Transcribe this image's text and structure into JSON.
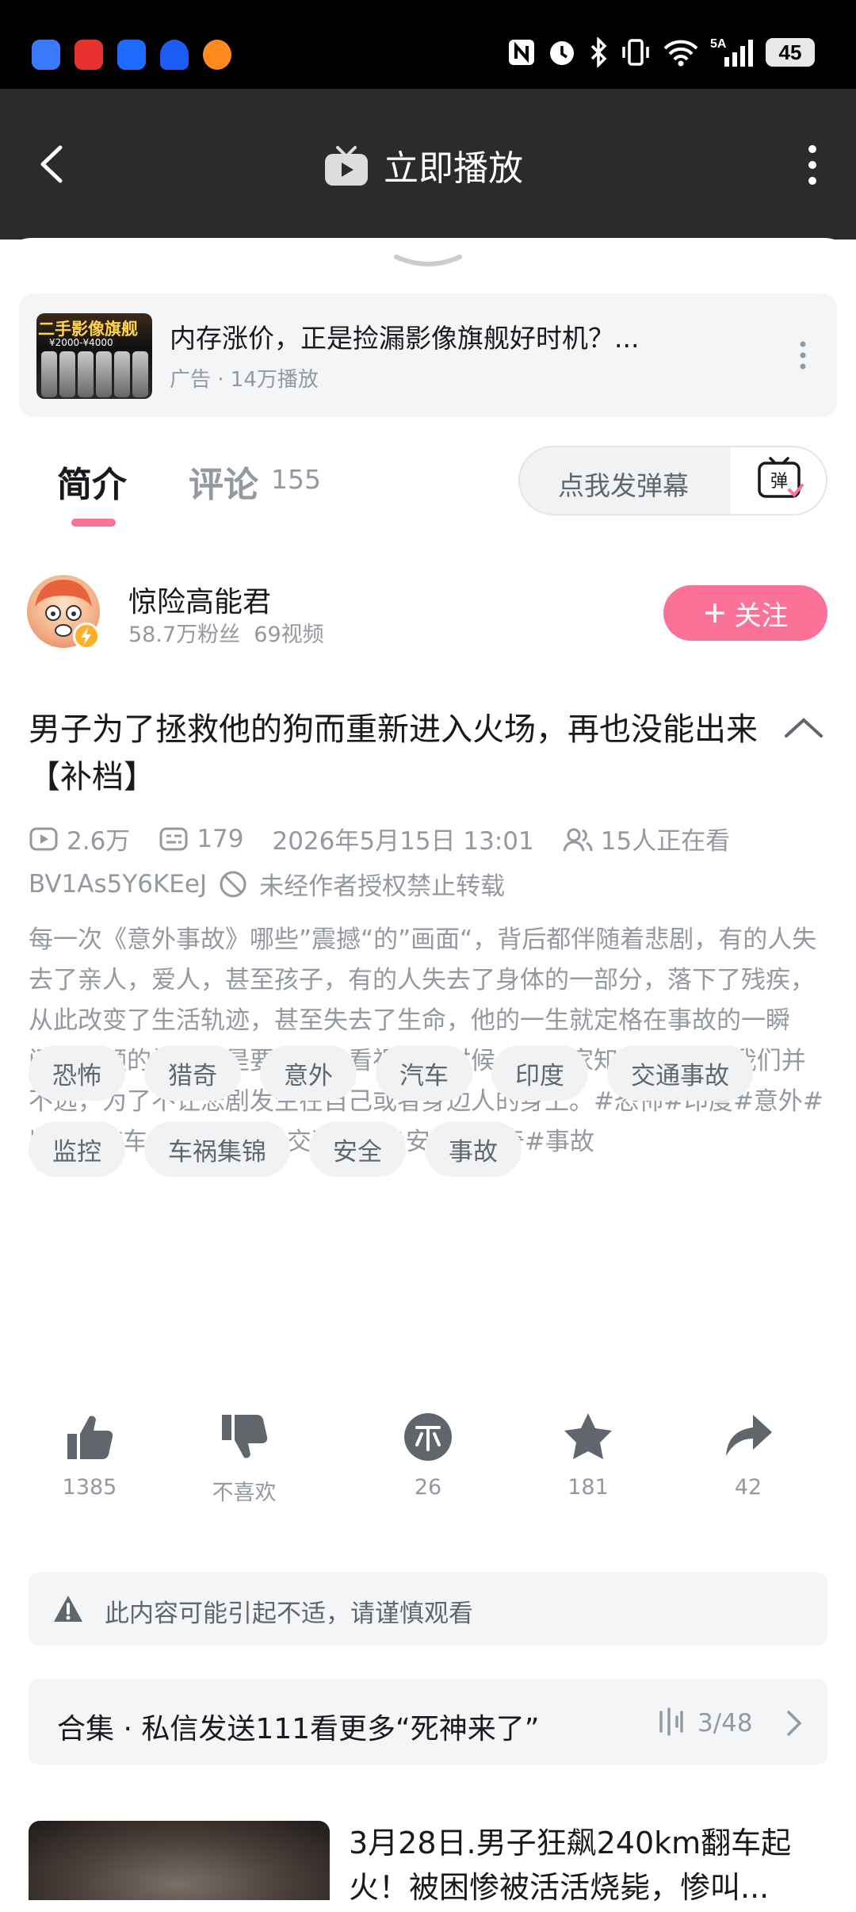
{
  "colors": {
    "accent": "#fb7299",
    "nav_bg": "#2b2b2d",
    "muted": "#9499a0"
  },
  "status_bar": {
    "network": "5A",
    "battery": "45"
  },
  "nav": {
    "title": "立即播放",
    "title_icon": "tv-play-icon"
  },
  "ad": {
    "thumb_text": "二手影像旗舰",
    "thumb_price": "¥2000-¥4000",
    "title": "内存涨价，正是捡漏影像旗舰好时机？...",
    "meta": "广告 · 14万播放"
  },
  "tabs": {
    "intro": "简介",
    "comments": "评论",
    "comments_count": "155"
  },
  "danmaku": {
    "placeholder": "点我发弹幕",
    "button_label": "弹"
  },
  "uploader": {
    "name": "惊险高能君",
    "fans": "58.7万粉丝",
    "videos": "69视频",
    "follow_label": "关注"
  },
  "video": {
    "title": "男子为了拯救他的狗而重新进入火场，再也没能出来【补档】",
    "views": "2.6万",
    "danmaku_count": "179",
    "date": "2026年5月15日 13:01",
    "watching": "15人正在看",
    "bvid": "BV1As5Y6KEeJ",
    "repost_notice": "未经作者授权禁止转载",
    "description": "每一次《意外事故》哪些”震撼“的”画面“，背后都伴随着悲剧，有的人失去了亲人，爱人，甚至孩子，有的人失去了身体的一部分，落下了残疾，从此改变了生活轨迹，甚至失去了生命，他的一生就定格在事故的一瞬间，视频的初衷就是要大家在看视频的时候，让大家知道 危险 离我们并不远，为了不让悲剧发生在自己或者身边人的身上。#恐怖#印度#意外#监控#汽车#车祸集锦#交通事故#安全#猎奇#事故"
  },
  "tags": [
    "恐怖",
    "猎奇",
    "意外",
    "汽车",
    "印度",
    "交通事故",
    "监控",
    "车祸集锦",
    "安全",
    "事故"
  ],
  "actions": {
    "like": "1385",
    "dislike": "不喜欢",
    "coin": "26",
    "favorite": "181",
    "share": "42"
  },
  "warning": {
    "text": "此内容可能引起不适，请谨慎观看"
  },
  "collection": {
    "title": "合集 · 私信发送111看更多“死神来了”",
    "progress": "3/48"
  },
  "recommendation": {
    "title": "3月28日.男子狂飙240km翻车起火！被困惨被活活烧毙，惨叫..."
  }
}
